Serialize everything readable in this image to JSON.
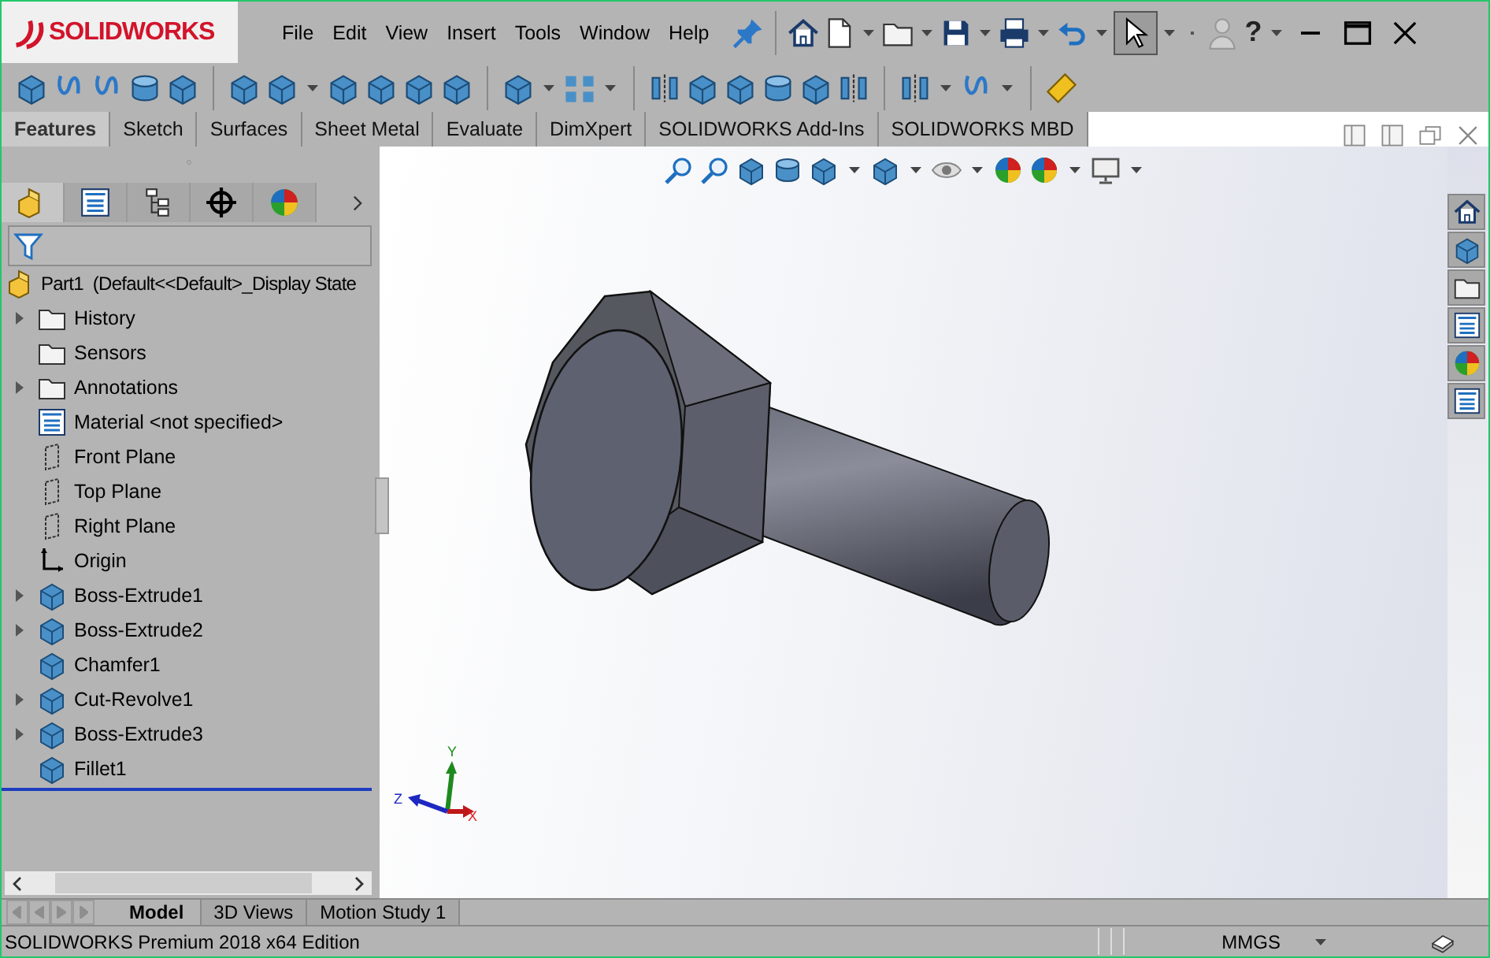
{
  "app_title": {
    "logo": "SOLIDWORKS"
  },
  "menu": [
    "File",
    "Edit",
    "View",
    "Insert",
    "Tools",
    "Window",
    "Help"
  ],
  "help_glyph": "?",
  "command_tabs": [
    {
      "label": "Features",
      "selected": true
    },
    {
      "label": "Sketch",
      "selected": false
    },
    {
      "label": "Surfaces",
      "selected": false
    },
    {
      "label": "Sheet Metal",
      "selected": false
    },
    {
      "label": "Evaluate",
      "selected": false
    },
    {
      "label": "DimXpert",
      "selected": false
    },
    {
      "label": "SOLIDWORKS Add-Ins",
      "selected": false
    },
    {
      "label": "SOLIDWORKS MBD",
      "selected": false
    }
  ],
  "feature_manager": {
    "panel_tabs": [
      {
        "selected": true
      },
      {
        "selected": false
      },
      {
        "selected": false
      },
      {
        "selected": false
      },
      {
        "selected": false
      }
    ],
    "root": "Part1  (Default<<Default>_Display State",
    "items": [
      {
        "label": "History",
        "expandable": true
      },
      {
        "label": "Sensors",
        "expandable": false
      },
      {
        "label": "Annotations",
        "expandable": true
      },
      {
        "label": "Material <not specified>",
        "expandable": false
      },
      {
        "label": "Front Plane",
        "expandable": false
      },
      {
        "label": "Top Plane",
        "expandable": false
      },
      {
        "label": "Right Plane",
        "expandable": false
      },
      {
        "label": "Origin",
        "expandable": false
      },
      {
        "label": "Boss-Extrude1",
        "expandable": true
      },
      {
        "label": "Boss-Extrude2",
        "expandable": true
      },
      {
        "label": "Chamfer1",
        "expandable": false
      },
      {
        "label": "Cut-Revolve1",
        "expandable": true
      },
      {
        "label": "Boss-Extrude3",
        "expandable": true
      },
      {
        "label": "Fillet1",
        "expandable": false
      }
    ]
  },
  "viewport": {
    "triad": {
      "x_label": "X",
      "y_label": "Y",
      "z_label": "Z"
    }
  },
  "bottom_tabs": [
    {
      "label": "Model",
      "selected": true
    },
    {
      "label": "3D Views",
      "selected": false
    },
    {
      "label": "Motion Study 1",
      "selected": false
    }
  ],
  "status_bar": {
    "edition": "SOLIDWORKS Premium 2018 x64 Edition",
    "units": "MMGS"
  }
}
